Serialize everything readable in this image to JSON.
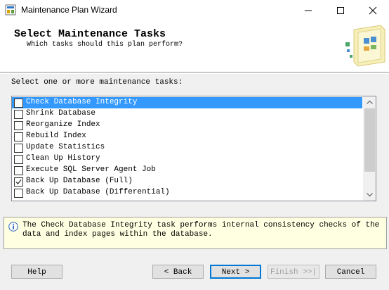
{
  "window": {
    "title": "Maintenance Plan Wizard",
    "minimize_icon": "minimize-icon",
    "maximize_icon": "maximize-icon",
    "close_icon": "close-icon"
  },
  "header": {
    "title": "Select Maintenance Tasks",
    "subtitle": "Which tasks should this plan perform?",
    "graphic_icon": "wizard-banner-icon"
  },
  "task_list": {
    "label": "Select one or more maintenance tasks:",
    "items": [
      {
        "label": "Check Database Integrity",
        "checked": false,
        "selected": true
      },
      {
        "label": "Shrink Database",
        "checked": false,
        "selected": false
      },
      {
        "label": "Reorganize Index",
        "checked": false,
        "selected": false
      },
      {
        "label": "Rebuild Index",
        "checked": false,
        "selected": false
      },
      {
        "label": "Update Statistics",
        "checked": false,
        "selected": false
      },
      {
        "label": "Clean Up History",
        "checked": false,
        "selected": false
      },
      {
        "label": "Execute SQL Server Agent Job",
        "checked": false,
        "selected": false
      },
      {
        "label": "Back Up Database (Full)",
        "checked": true,
        "selected": false
      },
      {
        "label": "Back Up Database (Differential)",
        "checked": false,
        "selected": false
      }
    ]
  },
  "info": {
    "icon": "info-icon",
    "text": "The Check Database Integrity task performs internal consistency checks of the data and index pages within the database."
  },
  "buttons": {
    "help": "Help",
    "back": "< Back",
    "next": "Next >",
    "finish": "Finish >>|",
    "cancel": "Cancel"
  },
  "colors": {
    "selection": "#3399ff",
    "info_background": "#ffffe1",
    "default_button_border": "#0078d7"
  }
}
